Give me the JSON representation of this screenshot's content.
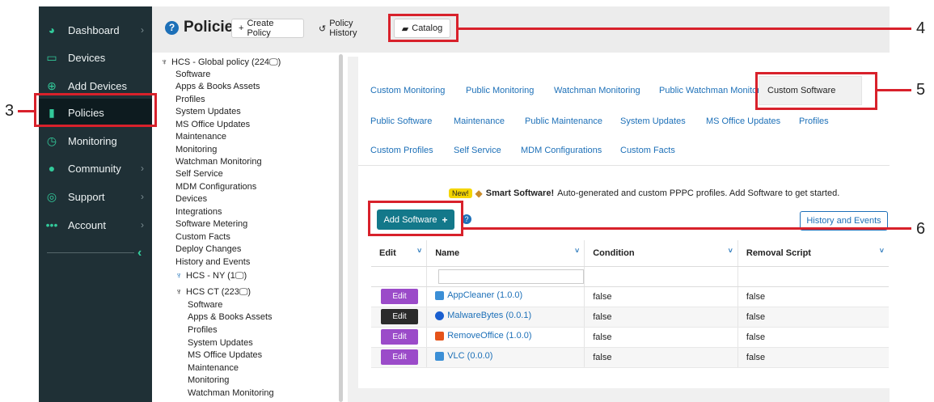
{
  "nav": {
    "items": [
      {
        "label": "Dashboard",
        "icon": "pie-chart-icon",
        "chevron": true
      },
      {
        "label": "Devices",
        "icon": "monitor-icon",
        "chevron": false
      },
      {
        "label": "Add Devices",
        "icon": "plus-circle-icon",
        "chevron": false
      },
      {
        "label": "Policies",
        "icon": "briefcase-icon",
        "chevron": false,
        "active": true
      },
      {
        "label": "Monitoring",
        "icon": "alarm-clock-icon",
        "chevron": false
      },
      {
        "label": "Community",
        "icon": "users-icon",
        "chevron": true
      },
      {
        "label": "Support",
        "icon": "lifebuoy-icon",
        "chevron": true
      },
      {
        "label": "Account",
        "icon": "ellipsis-icon",
        "chevron": true
      }
    ]
  },
  "header": {
    "title": "Policies",
    "create_policy": "Create Policy",
    "policy_history": "Policy History",
    "catalog": "Catalog"
  },
  "tree": {
    "global": "HCS - Global policy (224🖵)",
    "global_children": [
      "Software",
      "Apps & Books Assets",
      "Profiles",
      "System Updates",
      "MS Office Updates",
      "Maintenance",
      "Monitoring",
      "Watchman Monitoring",
      "Self Service",
      "MDM Configurations",
      "Devices",
      "Integrations",
      "Software Metering",
      "Custom Facts",
      "Deploy Changes",
      "History and Events"
    ],
    "ny": "HCS - NY (1🖵)",
    "ct": "HCS CT (223🖵)",
    "ct_children": [
      "Software",
      "Apps & Books Assets",
      "Profiles",
      "System Updates",
      "MS Office Updates",
      "Maintenance",
      "Monitoring",
      "Watchman Monitoring"
    ]
  },
  "tabs": {
    "row1": [
      "Custom Monitoring",
      "Public Monitoring",
      "Watchman Monitoring",
      "Public Watchman Monitoring",
      "Custom Software"
    ],
    "row2": [
      "Public Software",
      "Maintenance",
      "Public Maintenance",
      "System Updates",
      "MS Office Updates",
      "Profiles"
    ],
    "row3": [
      "Custom Profiles",
      "Self Service",
      "MDM Configurations",
      "Custom Facts"
    ],
    "active": "Custom Software"
  },
  "notice": {
    "badge": "New!",
    "bold": "Smart Software!",
    "text": "Auto-generated and custom PPPC profiles. Add Software to get started."
  },
  "actions": {
    "add_software": "Add Software",
    "history_events": "History and Events"
  },
  "table": {
    "columns": [
      "Edit",
      "Name",
      "Condition",
      "Removal Script"
    ],
    "rows": [
      {
        "edit": "Edit",
        "name": "AppCleaner (1.0.0)",
        "condition": "false",
        "removal": "false",
        "icon": "appcleaner-icon"
      },
      {
        "edit": "Edit",
        "name": "MalwareBytes (0.0.1)",
        "condition": "false",
        "removal": "false",
        "icon": "malwarebytes-icon"
      },
      {
        "edit": "Edit",
        "name": "RemoveOffice (1.0.0)",
        "condition": "false",
        "removal": "false",
        "icon": "office-icon"
      },
      {
        "edit": "Edit",
        "name": "VLC (0.0.0)",
        "condition": "false",
        "removal": "false",
        "icon": "vlc-icon"
      }
    ]
  },
  "callouts": [
    "3",
    "4",
    "5",
    "6"
  ],
  "colors": {
    "sidebar": "#1f3036",
    "accent_green": "#32c99a",
    "link_blue": "#1d70b8",
    "callout_red": "#d8212b",
    "edit_purple": "#9b4bc9",
    "add_teal": "#13788a"
  }
}
